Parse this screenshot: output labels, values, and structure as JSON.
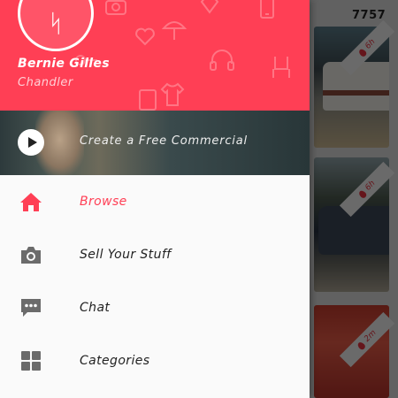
{
  "background": {
    "price_text": "7757",
    "listing_ages": [
      "6h",
      "6h",
      "2m"
    ]
  },
  "drawer": {
    "user": {
      "name": "Bernie Gilles",
      "location": "Chandler"
    },
    "promo": {
      "label": "Create a Free Commercial",
      "icon": "play-icon"
    },
    "menu": [
      {
        "label": "Browse",
        "icon": "home-icon",
        "active": true
      },
      {
        "label": "Sell Your Stuff",
        "icon": "camera-icon",
        "active": false
      },
      {
        "label": "Chat",
        "icon": "chat-icon",
        "active": false
      },
      {
        "label": "Categories",
        "icon": "grid-icon",
        "active": false
      }
    ]
  },
  "colors": {
    "accent": "#ff3f55",
    "active_text": "#ff3f55",
    "icon_active": "#ff3f55",
    "icon_inactive": "#6b6b6b"
  }
}
